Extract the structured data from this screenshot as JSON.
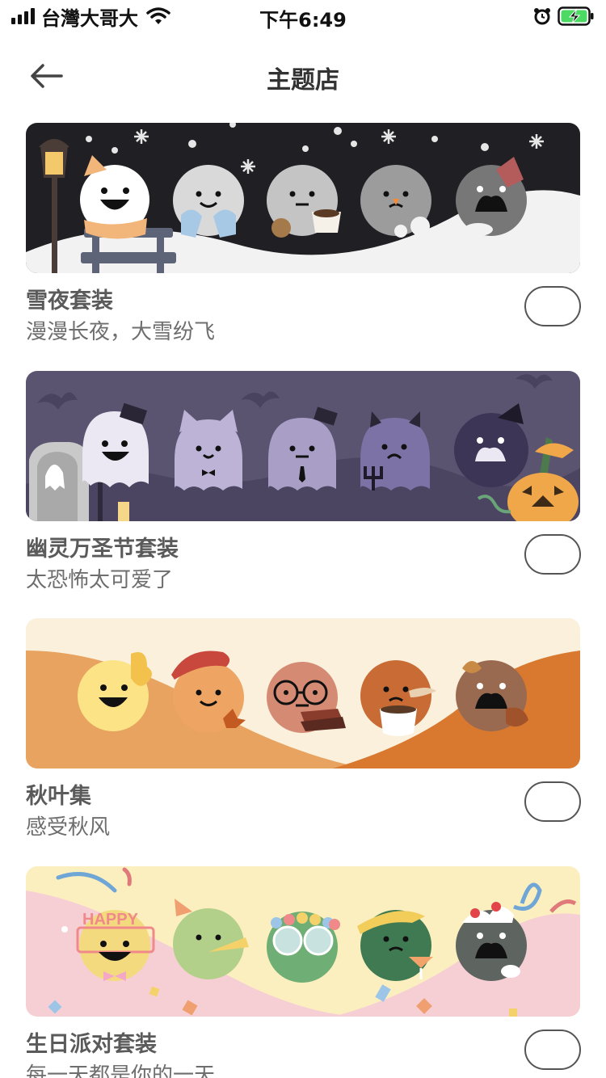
{
  "status_bar": {
    "carrier": "台灣大哥大",
    "time": "下午6:49",
    "icons": [
      "signal-icon",
      "wifi-icon",
      "alarm-icon",
      "battery-charging-icon"
    ]
  },
  "nav": {
    "title": "主题店",
    "back_icon": "back-arrow-icon"
  },
  "themes": [
    {
      "name": "雪夜套装",
      "desc": "漫漫长夜，大雪纷飞",
      "selected": false
    },
    {
      "name": "幽灵万圣节套装",
      "desc": "太恐怖太可爱了",
      "selected": false
    },
    {
      "name": "秋叶集",
      "desc": "感受秋风",
      "selected": false
    },
    {
      "name": "生日派对套装",
      "desc": "每一天都是你的一天",
      "selected": false
    }
  ],
  "banner_text": {
    "birthday_hat": "HAPPY"
  },
  "colors": {
    "snow_bg": "#1f1f24",
    "ghost_bg": "#5b5470",
    "autumn_bg": "#fbf0dc",
    "birthday_bg": "#fbefc0"
  }
}
